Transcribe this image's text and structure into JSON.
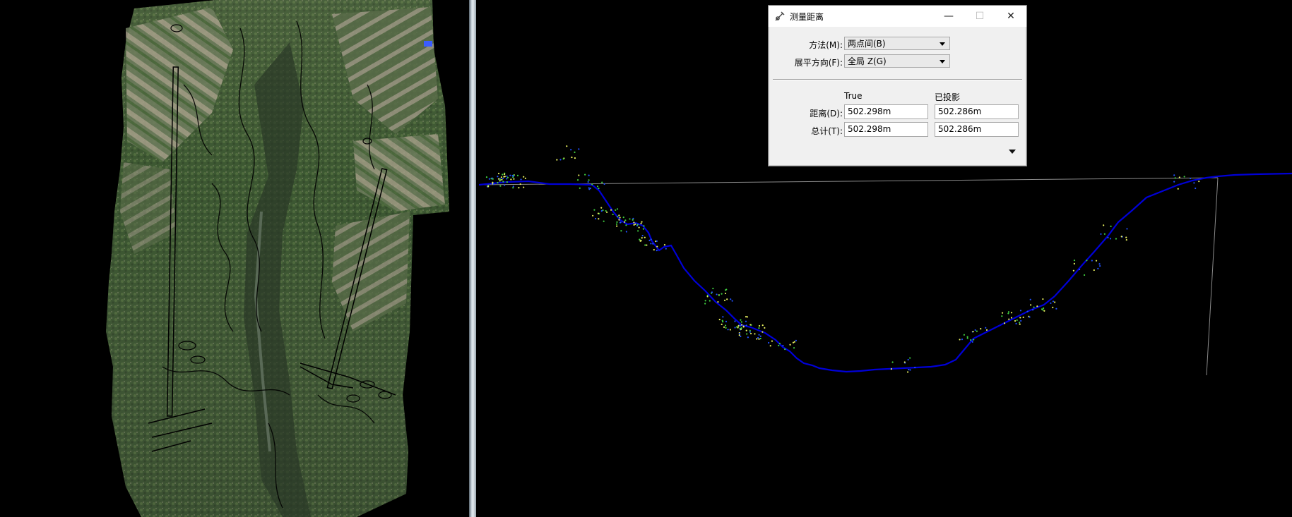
{
  "dialog": {
    "title": "测量距离",
    "title_icon": "measure-tool-icon",
    "window_buttons": {
      "minimize": "—",
      "maximize": "☐",
      "close": "✕"
    },
    "method_label": "方法(M):",
    "method_value": "两点间(B)",
    "flatten_label": "展平方向(F):",
    "flatten_value": "全局 Z(G)",
    "col_true": "True",
    "col_projected": "已投影",
    "distance_label": "距离(D):",
    "distance_true": "502.298m",
    "distance_projected": "502.286m",
    "total_label": "总计(T):",
    "total_true": "502.298m",
    "total_projected": "502.286m",
    "expand_icon": "chevron-down-icon"
  },
  "colors": {
    "profile_line": "#0000d8",
    "profile_points_yellow": "#e8f060",
    "profile_points_green": "#40d040",
    "ortho_vegetation": "#3f5a34",
    "splitter": "#c9d4dc"
  }
}
